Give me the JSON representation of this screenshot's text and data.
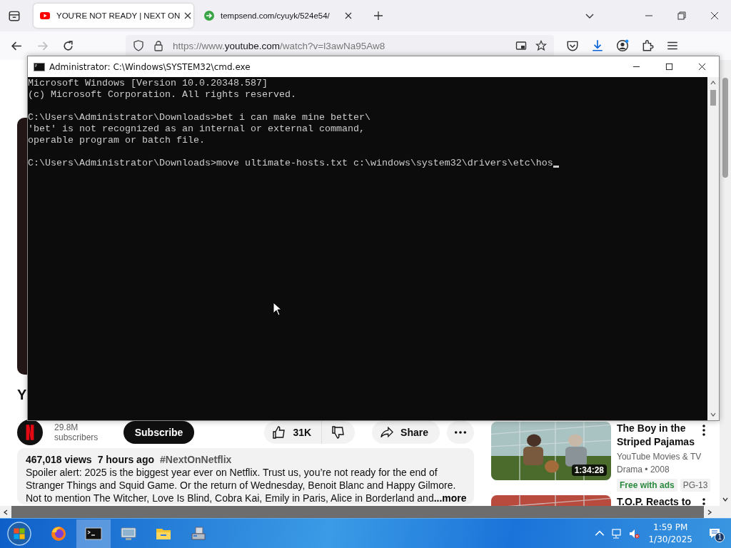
{
  "browser": {
    "tabs": [
      {
        "title": "YOU'RE NOT READY | NEXT ON",
        "kind": "youtube",
        "selected": true
      },
      {
        "title": "tempsend.com/cyuyk/524e54/",
        "kind": "tempsend",
        "selected": false
      }
    ],
    "url": {
      "prefix": "https://www.",
      "domain": "youtube.com",
      "path": "/watch?v=l3awNa95Aw8"
    }
  },
  "video": {
    "title": "Y",
    "subscribers": "29.8M subscribers",
    "subscribe": "Subscribe",
    "likes": "31K",
    "share": "Share",
    "description": {
      "views": "467,018 views",
      "age": "7 hours ago",
      "hashtag": "#NextOnNetflix",
      "lines": [
        "Spoiler alert: 2025 is the biggest year ever on Netflix. Trust us, you’re not ready for the end of",
        "Stranger Things and Squid Game. Or the return of Wednesday, Benoit Blanc and Happy Gilmore.",
        "Not to mention The Witcher, Love Is Blind, Cobra Kai, Emily in Paris, Alice in Borderland and"
      ],
      "more": "...more"
    }
  },
  "recommendations": [
    {
      "title_lines": [
        "The Boy in the",
        "Striped Pajamas"
      ],
      "channel": "YouTube Movies & TV",
      "meta": "Drama • 2008",
      "badges": [
        "Free with ads",
        "PG-13"
      ],
      "duration": "1:34:28"
    },
    {
      "title_lines": [
        "T.O.P. Reacts to"
      ]
    }
  ],
  "cmd": {
    "title": "Administrator: C:\\Windows\\SYSTEM32\\cmd.exe",
    "blocks": [
      [
        "Microsoft Windows [Version 10.0.20348.587]",
        "(c) Microsoft Corporation. All rights reserved."
      ],
      [
        "C:\\Users\\Administrator\\Downloads>bet i can make mine better\\",
        "'bet' is not recognized as an internal or external command,",
        "operable program or batch file."
      ],
      [
        "C:\\Users\\Administrator\\Downloads>move ultimate-hosts.txt c:\\windows\\system32\\drivers\\etc\\hos"
      ]
    ]
  },
  "taskbar": {
    "apps": [
      {
        "kind": "firefox",
        "selected": false
      },
      {
        "kind": "terminal",
        "selected": true
      },
      {
        "kind": "monitor",
        "selected": false
      },
      {
        "kind": "folder",
        "selected": false
      },
      {
        "kind": "installer",
        "selected": false
      }
    ],
    "time": "1:59 PM",
    "date": "1/30/2025",
    "notifications": "1"
  }
}
